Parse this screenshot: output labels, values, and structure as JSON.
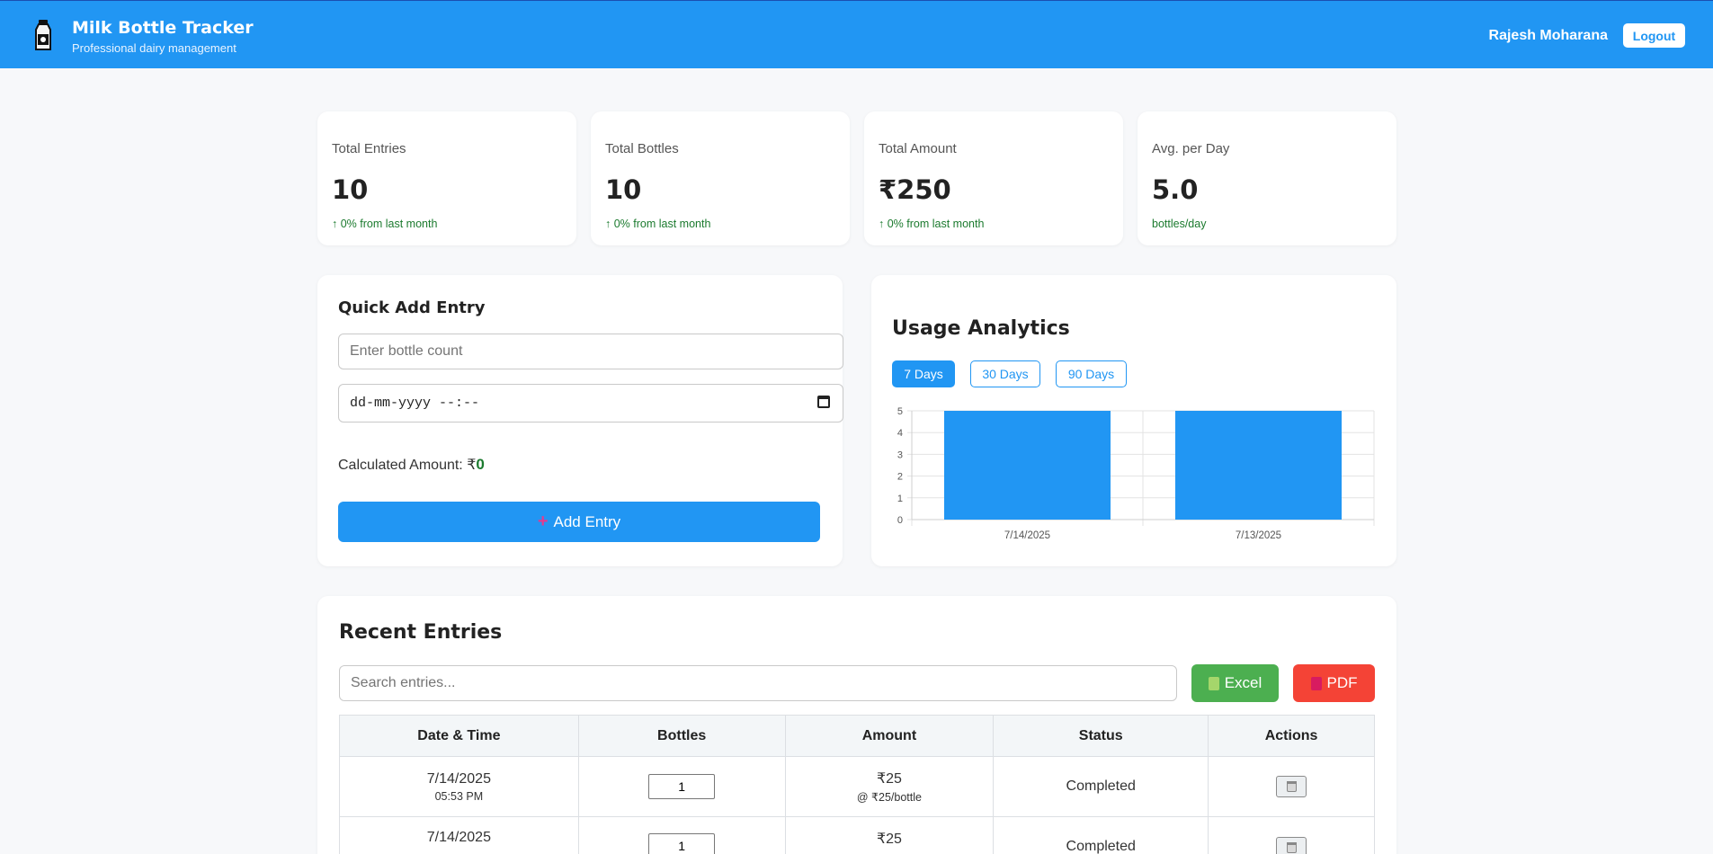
{
  "header": {
    "title": "Milk Bottle Tracker",
    "subtitle": "Professional dairy management",
    "user_name": "Rajesh Moharana",
    "logout_label": "Logout",
    "logo_icon": "milk-bottle-icon"
  },
  "stats": [
    {
      "label": "Total Entries",
      "value": "10",
      "note": "↑ 0% from last month"
    },
    {
      "label": "Total Bottles",
      "value": "10",
      "note": "↑ 0% from last month"
    },
    {
      "label": "Total Amount",
      "value": "₹250",
      "note": "↑ 0% from last month"
    },
    {
      "label": "Avg. per Day",
      "value": "5.0",
      "note": "bottles/day"
    }
  ],
  "quick_add": {
    "title": "Quick Add Entry",
    "count_placeholder": "Enter bottle count",
    "datetime_placeholder": "dd-mm-yyyy --:--",
    "calc_label": "Calculated Amount: ₹",
    "calc_value": "0",
    "add_label": "Add Entry"
  },
  "analytics": {
    "title": "Usage Analytics",
    "ranges": [
      "7 Days",
      "30 Days",
      "90 Days"
    ],
    "active_range": "7 Days"
  },
  "chart_data": {
    "type": "bar",
    "categories": [
      "7/14/2025",
      "7/13/2025"
    ],
    "values": [
      5,
      5
    ],
    "ylim": [
      0,
      5
    ],
    "yticks": [
      "0",
      "1",
      "2",
      "3",
      "4",
      "5"
    ],
    "grid": true,
    "color": "#2196f3"
  },
  "recent": {
    "title": "Recent Entries",
    "search_placeholder": "Search entries...",
    "excel_label": "Excel",
    "pdf_label": "PDF",
    "columns": [
      "Date & Time",
      "Bottles",
      "Amount",
      "Status",
      "Actions"
    ],
    "rows": [
      {
        "date": "7/14/2025",
        "time": "05:53 PM",
        "bottles": "1",
        "amount": "₹25",
        "rate": "@ ₹25/bottle",
        "status": "Completed"
      },
      {
        "date": "7/14/2025",
        "time": "",
        "bottles": "1",
        "amount": "₹25",
        "rate": "",
        "status": "Completed"
      }
    ]
  },
  "colors": {
    "primary": "#2196f3",
    "success": "#4caf50",
    "danger": "#f44336",
    "positive_text": "#1b7a2e"
  }
}
